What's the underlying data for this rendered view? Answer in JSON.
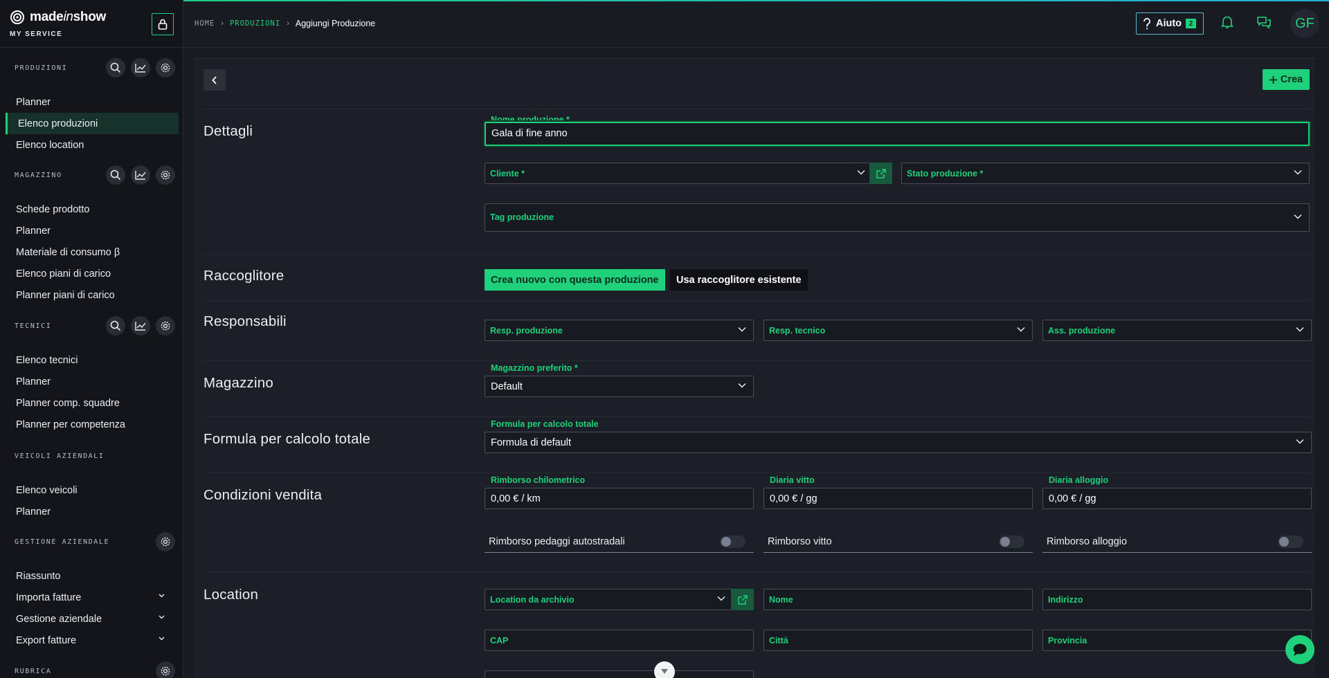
{
  "brand": {
    "name_prefix": "made",
    "name_italic": "in",
    "name_suffix": "show",
    "subtitle": "MY SERVICE"
  },
  "header": {
    "breadcrumb": {
      "home": "HOME",
      "section": "PRODUZIONI",
      "current": "Aggiungi Produzione"
    },
    "help_label": "Aiuto",
    "help_count": "2",
    "avatar_initials": "GF"
  },
  "sidebar": {
    "produzioni": {
      "title": "PRODUZIONI",
      "items": [
        "Planner",
        "Elenco produzioni",
        "Elenco location"
      ]
    },
    "magazzino": {
      "title": "MAGAZZINO",
      "items": [
        "Schede prodotto",
        "Planner",
        "Materiale di consumo β",
        "Elenco piani di carico",
        "Planner piani di carico"
      ]
    },
    "tecnici": {
      "title": "TECNICI",
      "items": [
        "Elenco tecnici",
        "Planner",
        "Planner comp. squadre",
        "Planner per competenza"
      ]
    },
    "veicoli": {
      "title": "VEICOLI AZIENDALI",
      "items": [
        "Elenco veicoli",
        "Planner"
      ]
    },
    "gestione": {
      "title": "GESTIONE AZIENDALE",
      "items": [
        "Riassunto",
        "Importa fatture",
        "Gestione aziendale",
        "Export fatture"
      ]
    },
    "rubrica": {
      "title": "RUBRICA"
    }
  },
  "toolbar": {
    "create_label": "Crea"
  },
  "form": {
    "dettagli": {
      "title": "Dettagli",
      "nome_label": "Nome produzione *",
      "nome_value": "Gala di fine anno",
      "cliente_label": "Cliente *",
      "stato_label": "Stato produzione *",
      "tag_label": "Tag produzione"
    },
    "raccoglitore": {
      "title": "Raccoglitore",
      "option_new": "Crea nuovo con questa produzione",
      "option_existing": "Usa raccoglitore esistente"
    },
    "responsabili": {
      "title": "Responsabili",
      "resp_prod": "Resp. produzione",
      "resp_tec": "Resp. tecnico",
      "ass_prod": "Ass. produzione"
    },
    "magazzino": {
      "title": "Magazzino",
      "label": "Magazzino preferito *",
      "value": "Default"
    },
    "formula": {
      "title": "Formula per calcolo totale",
      "label": "Formula per calcolo totale",
      "value": "Formula di default"
    },
    "condizioni": {
      "title": "Condizioni vendita",
      "rimborso_km_label": "Rimborso chilometrico",
      "rimborso_km_value": "0,00 € / km",
      "vitto_label": "Diaria vitto",
      "vitto_value": "0,00 € / gg",
      "alloggio_label": "Diaria alloggio",
      "alloggio_value": "0,00 € / gg",
      "toggle_pedaggi": "Rimborso pedaggi autostradali",
      "toggle_vitto": "Rimborso vitto",
      "toggle_alloggio": "Rimborso alloggio"
    },
    "location": {
      "title": "Location",
      "archivio_label": "Location da archivio",
      "nome_label": "Nome",
      "indirizzo_label": "Indirizzo",
      "cap_label": "CAP",
      "citta_label": "Città",
      "provincia_label": "Provincia"
    }
  },
  "colors": {
    "accent": "#1fd17a",
    "background": "#191b22",
    "sidebar": "#13151b",
    "help_border": "#5fb6d6"
  }
}
